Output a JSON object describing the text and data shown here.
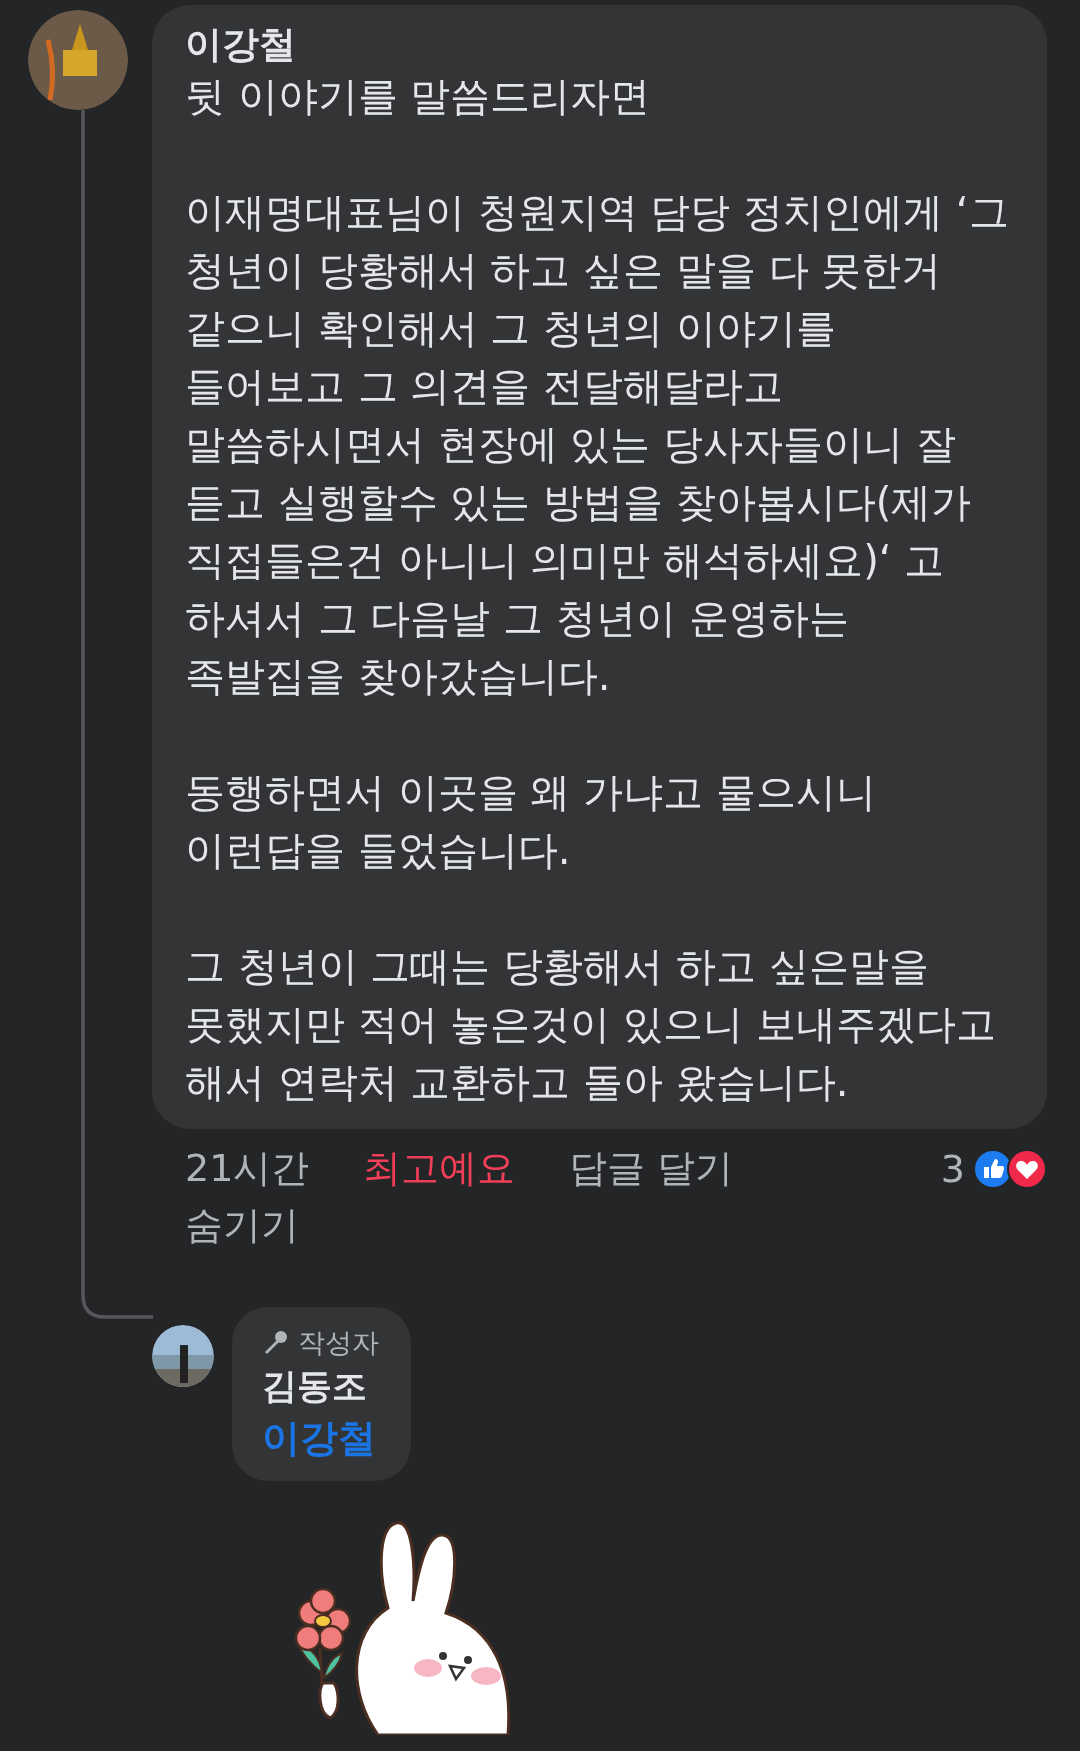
{
  "comment": {
    "author": "이강철",
    "paragraphs": [
      "뒷 이야기를 말씀드리자면",
      "이재명대표님이 청원지역 담당 정치인에게 ‘그\n청년이 당황해서 하고 싶은 말을 다 못한거\n같으니 확인해서 그 청년의 이야기를\n들어보고 그 의견을 전달해달라고\n말씀하시면서 현장에 있는 당사자들이니 잘\n듣고 실행할수 있는 방법을 찾아봅시다(제가\n직접들은건 아니니 의미만 해석하세요)‘ 고\n하셔서 그 다음날 그 청년이 운영하는\n족발집을 찾아갔습니다.",
      "동행하면서 이곳을 왜 가냐고 물으시니\n이런답을 들었습니다.",
      "그 청년이 그때는 당황해서 하고 싶은말을\n못했지만 적어 놓은것이 있으니 보내주겠다고\n해서 연락처 교환하고 돌아 왔습니다."
    ],
    "time": "21시간",
    "reaction_button": {
      "label": "최고예요",
      "reacted": true
    },
    "reply_button": "답글 달기",
    "hide_button": "숨기기",
    "reaction_count": "3"
  },
  "reply": {
    "badge": "작성자",
    "author": "김동조",
    "mention": "이강철",
    "sticker": true
  }
}
